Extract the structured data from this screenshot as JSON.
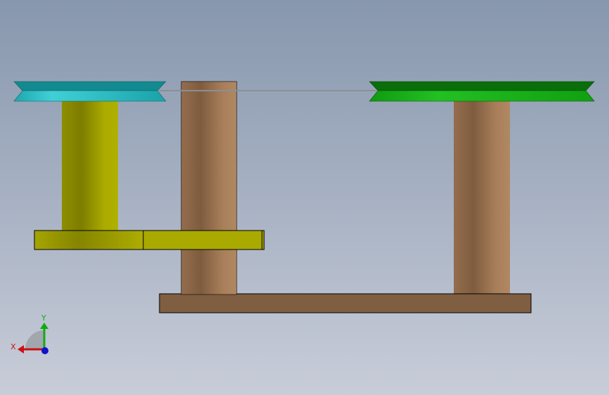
{
  "viewport": {
    "background_top": "#8797ad",
    "background_bottom": "#c8cdd8"
  },
  "parts": {
    "left_pulley": {
      "color_light": "#39c7cc",
      "color_dark": "#138a90"
    },
    "right_pulley": {
      "color_light": "#1bb91b",
      "color_dark": "#0a6e0a"
    },
    "belt": {
      "color": "#8a8f96"
    },
    "left_shaft": {
      "color_light": "#b0b000",
      "color_dark": "#7d7d00"
    },
    "left_plate": {
      "color_light": "#b0b000",
      "color_dark": "#7d7d00"
    },
    "middle_post": {
      "color_light": "#ad8560",
      "color_dark": "#7f5c3f"
    },
    "right_post": {
      "color_light": "#ad8560",
      "color_dark": "#7f5c3f"
    },
    "base_plate": {
      "color": "#7f5e41"
    }
  },
  "triad": {
    "x_label": "X",
    "y_label": "Y",
    "x_color": "#cc1111",
    "y_color": "#11aa11",
    "z_color": "#1111cc"
  }
}
